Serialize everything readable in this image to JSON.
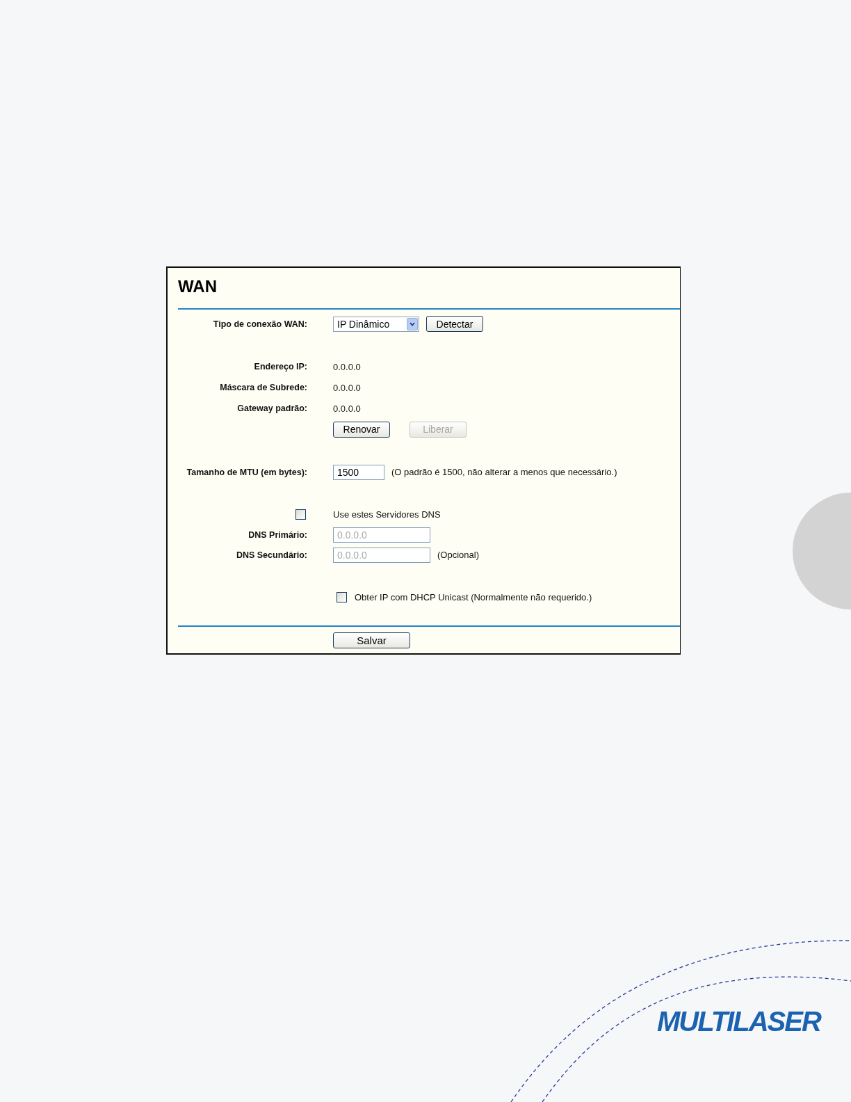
{
  "panel": {
    "title": "WAN",
    "sections": [
      [
        {
          "kind": "select",
          "label": "Tipo de conexão WAN:",
          "value": "IP Dinâmico",
          "button": "Detectar"
        }
      ],
      [
        {
          "kind": "info",
          "label": "Endereço IP:",
          "value": "0.0.0.0"
        },
        {
          "kind": "info",
          "label": "Máscara de Subrede:",
          "value": "0.0.0.0"
        },
        {
          "kind": "info",
          "label": "Gateway padrão:",
          "value": "0.0.0.0"
        },
        {
          "kind": "buttons",
          "buttons": [
            {
              "label": "Renovar",
              "disabled": false
            },
            {
              "label": "Liberar",
              "disabled": true
            }
          ]
        }
      ],
      [
        {
          "kind": "input",
          "label": "Tamanho de MTU (em bytes):",
          "value": "1500",
          "note": "(O padrão é 1500, não alterar a menos que necessário.)"
        }
      ],
      [
        {
          "kind": "checkbox",
          "text": "Use estes Servidores DNS",
          "checked": false
        },
        {
          "kind": "input",
          "label": "DNS Primário:",
          "placeholder": "0.0.0.0"
        },
        {
          "kind": "input",
          "label": "DNS Secundário:",
          "placeholder": "0.0.0.0",
          "note": "(Opcional)"
        }
      ],
      [
        {
          "kind": "checkbox-inline",
          "text": "Obter IP com DHCP Unicast (Normalmente não requerido.)",
          "checked": false
        }
      ]
    ],
    "save_button": "Salvar"
  },
  "logo": "MULTILASER"
}
